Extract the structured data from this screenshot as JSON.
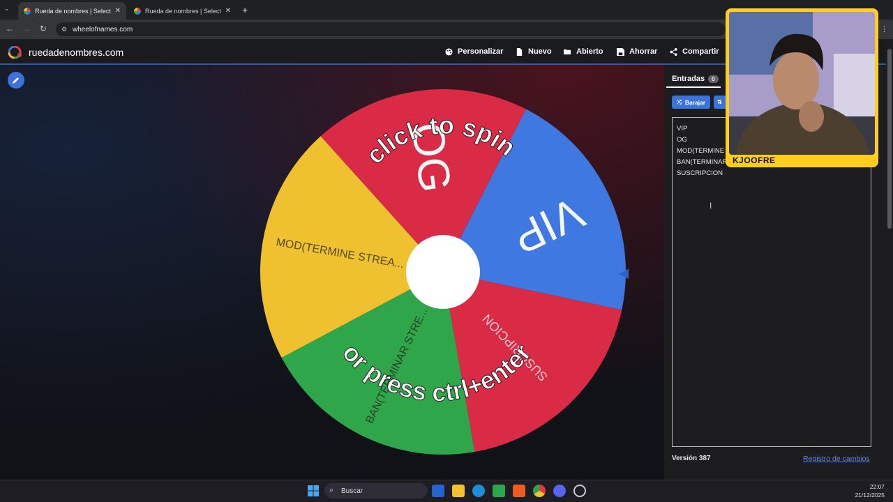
{
  "browser": {
    "tabs": [
      {
        "title": "Rueda de nombres | Selector de",
        "active": true
      },
      {
        "title": "Rueda de nombres | Selector de",
        "active": false
      }
    ],
    "new_tab_label": "+",
    "url": "wheelofnames.com"
  },
  "site": {
    "brand": "ruedadenombres.com",
    "menu": [
      {
        "label": "Personalizar",
        "icon": "palette-icon"
      },
      {
        "label": "Nuevo",
        "icon": "file-icon"
      },
      {
        "label": "Abierto",
        "icon": "folder-open-icon"
      },
      {
        "label": "Ahorrar",
        "icon": "save-icon"
      },
      {
        "label": "Compartir",
        "icon": "share-icon"
      }
    ]
  },
  "wheel": {
    "center_text_top": "click to spin",
    "center_text_bottom": "or press ctrl+enter",
    "segments": [
      {
        "label": "VIP",
        "color": "#3f78e0"
      },
      {
        "label": "SUSCRIPCION",
        "color": "#d92b45"
      },
      {
        "label": "BAN(TERMINAR STRE...",
        "color": "#2fa64a"
      },
      {
        "label": "MOD(TERMINE STREA...",
        "color": "#f0c12e"
      },
      {
        "label": "OG",
        "color": "#d92b45"
      }
    ]
  },
  "sidebar": {
    "tab_label": "Entradas",
    "tab_count": "0",
    "shuffle_label": "Barajar",
    "entries_text": "VIP\nOG\nMOD(TERMINE STREAM)\nBAN(TERMINAR STREAM)\nSUSCRIPCION",
    "version": "Versión 387",
    "changelog": "Registro de cambios"
  },
  "webcam": {
    "name": "KJOOFRE",
    "border_color": "#ffce1f"
  },
  "taskbar": {
    "search_placeholder": "Buscar",
    "time": "22:07",
    "date": "21/12/2025"
  }
}
